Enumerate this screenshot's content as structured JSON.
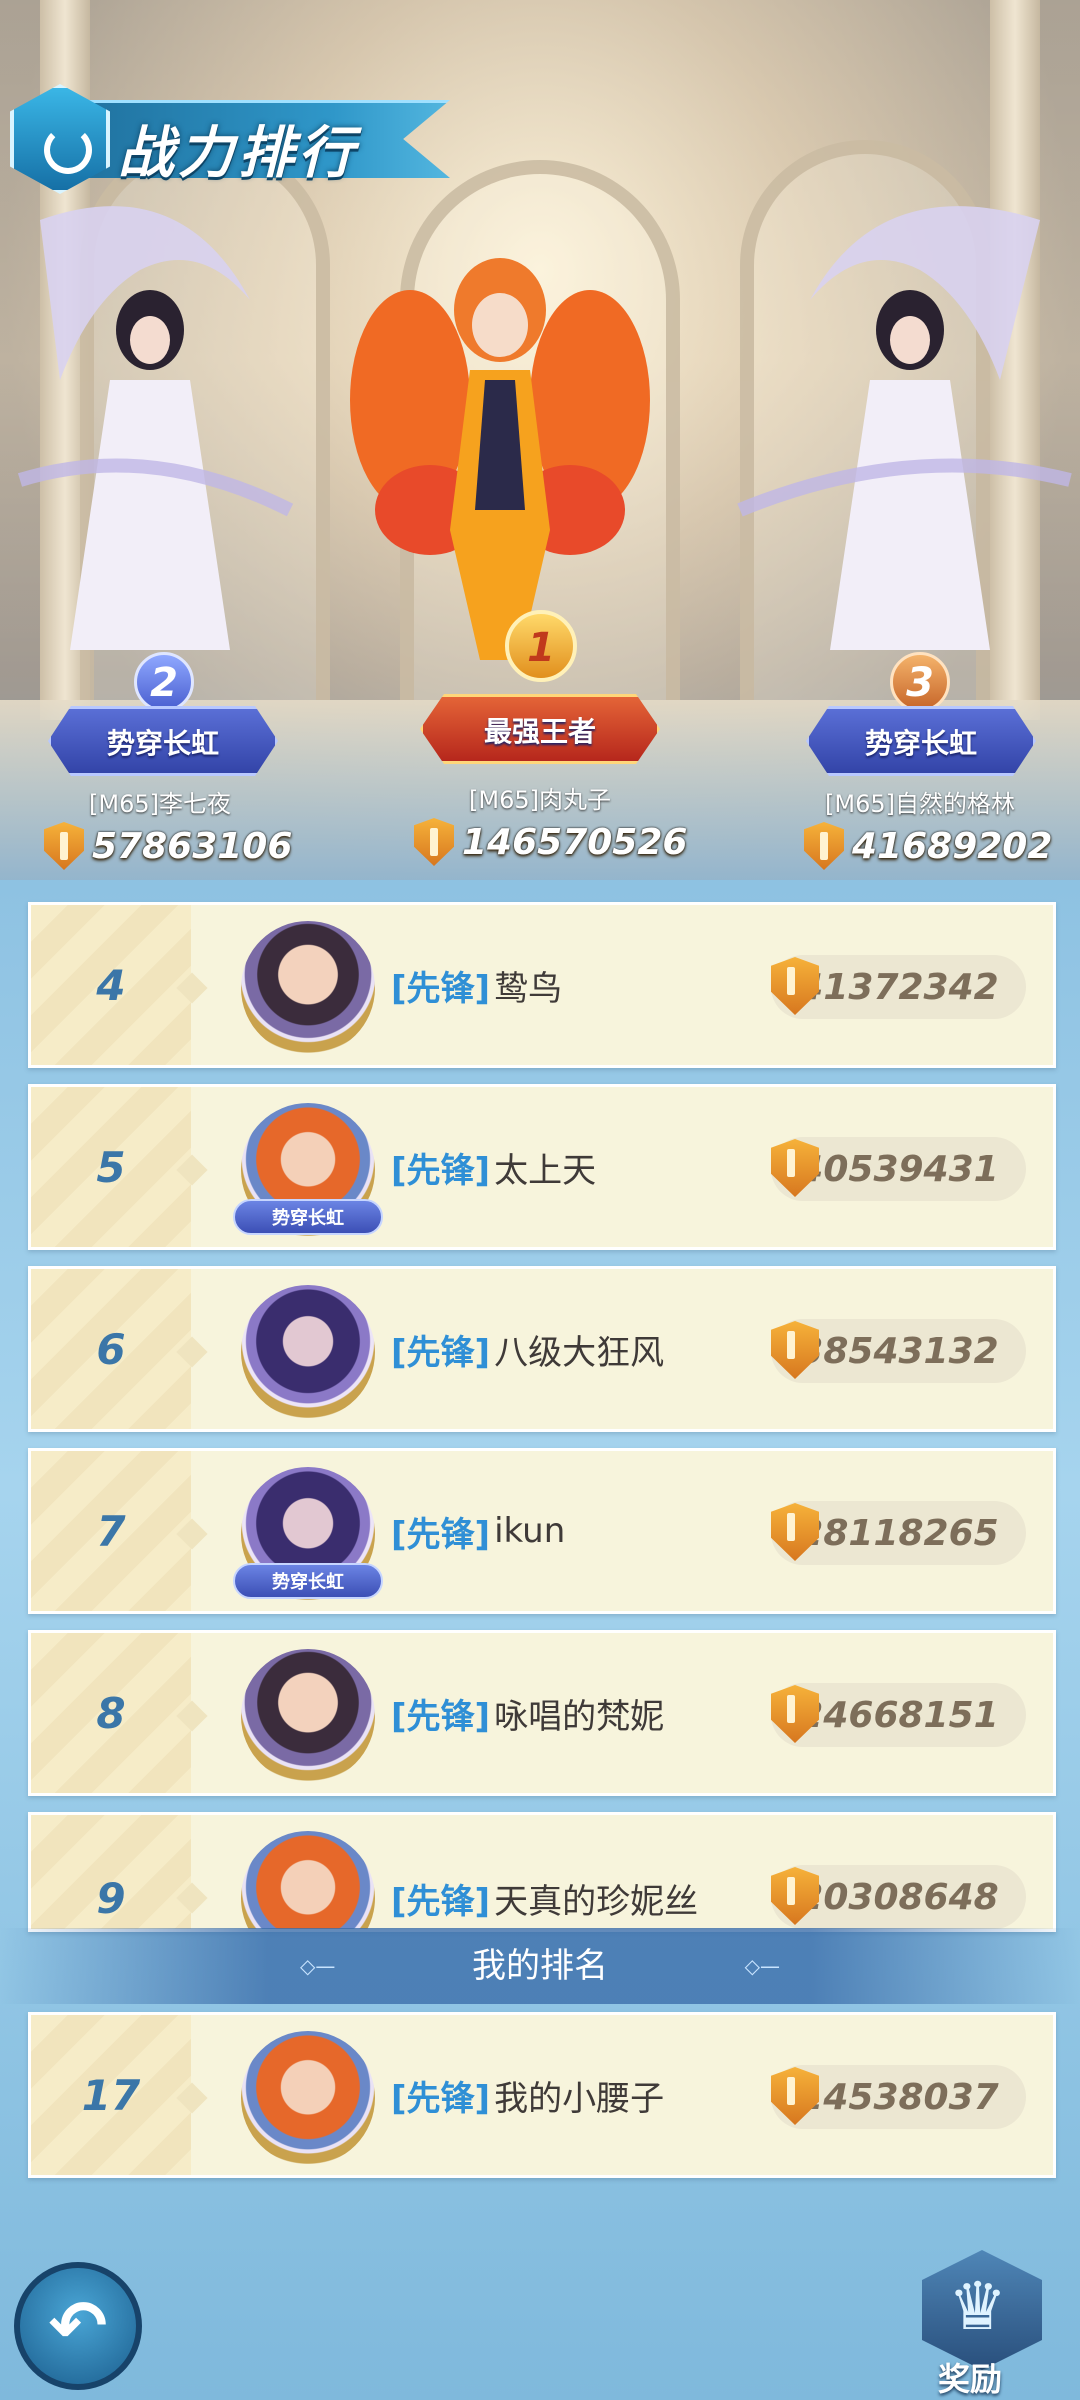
{
  "header": {
    "title": "战力排行"
  },
  "podium": {
    "first": {
      "rank": "1",
      "badge": "最强王者",
      "name": "[M65]肉丸子",
      "power": "146570526"
    },
    "second": {
      "rank": "2",
      "badge": "势穿长虹",
      "name": "[M65]李七夜",
      "power": "57863106"
    },
    "third": {
      "rank": "3",
      "badge": "势穿长虹",
      "name": "[M65]自然的格林",
      "power": "41689202"
    }
  },
  "ranking": [
    {
      "rank": "4",
      "tag": "[先锋]",
      "name": "鸷鸟",
      "power": "41372342",
      "avatar": "dark-hair-female",
      "title_badge": ""
    },
    {
      "rank": "5",
      "tag": "[先锋]",
      "name": "太上天",
      "power": "40539431",
      "avatar": "orange-hair-elf",
      "title_badge": "势穿长虹"
    },
    {
      "rank": "6",
      "tag": "[先锋]",
      "name": "八级大狂风",
      "power": "38543132",
      "avatar": "purple-hair-masked",
      "title_badge": ""
    },
    {
      "rank": "7",
      "tag": "[先锋]",
      "name": "ikun",
      "power": "28118265",
      "avatar": "purple-hair-masked",
      "title_badge": "势穿长虹"
    },
    {
      "rank": "8",
      "tag": "[先锋]",
      "name": "咏唱的梵妮",
      "power": "24668151",
      "avatar": "dark-hair-female",
      "title_badge": ""
    },
    {
      "rank": "9",
      "tag": "[先锋]",
      "name": "天真的珍妮丝",
      "power": "20308648",
      "avatar": "orange-hair-elf",
      "title_badge": ""
    }
  ],
  "my_rank": {
    "section_label": "我的排名",
    "rank": "17",
    "tag": "[先锋]",
    "name": "我的小腰子",
    "power": "14538037"
  },
  "footer": {
    "back_icon": "back-arrow-icon",
    "reward_label": "奖励",
    "reward_icon": "crown-icon"
  },
  "colors": {
    "accent_blue": "#2f8fd6",
    "row_bg": "#f7f4dc",
    "rank_text": "#3b76a8",
    "power_gold": "#e08a2a"
  }
}
